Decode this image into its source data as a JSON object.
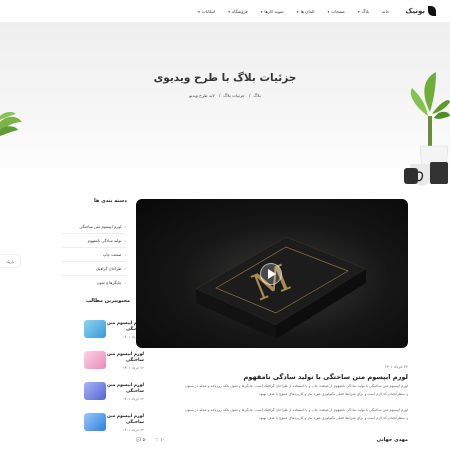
{
  "brand": {
    "name": "بونیک"
  },
  "nav": {
    "items": [
      {
        "label": "خانه"
      },
      {
        "label": "بلاگ"
      },
      {
        "label": "صفحات"
      },
      {
        "label": "المان ها"
      },
      {
        "label": "نمونه کارها"
      },
      {
        "label": "فروشگاه"
      },
      {
        "label": "امکانات"
      }
    ]
  },
  "hero": {
    "title": "جزئیات بلاگ با طرح ویدیوی",
    "crumbs": [
      "بلاگ",
      "جزئیات بلاگ",
      "لاید طرح ویدیو"
    ]
  },
  "sidebar": {
    "categories_title": "دسته بندی ها",
    "categories": [
      "لورم ایپسوم متن ساختگی",
      "تولید سادگی نامفهوم",
      "صنعت چاپ",
      "طراحان گرافیک",
      "چاپگرها و متون"
    ],
    "popular_title": "محبوبترین مطالب",
    "popular": [
      {
        "title": "لورم ایپسوم متن ساختگی",
        "date": "۲۶ خرداد ۱۴۰۱",
        "color": "#5bb6e6"
      },
      {
        "title": "لورم ایپسوم متن ساختگی",
        "date": "۲۲ خرداد ۱۴۰۱",
        "color": "#f3a8c8"
      },
      {
        "title": "لورم ایپسوم متن ساختگی",
        "date": "۲۲ خرداد ۱۴۰۱",
        "color": "#6b7fe0"
      },
      {
        "title": "لورم ایپسوم متن ساختگی",
        "date": "۲۲ خرداد ۱۴۰۱",
        "color": "#3b8ee6"
      }
    ]
  },
  "float_tab": {
    "label": "تاریک"
  },
  "post": {
    "date": "۲۴ خرداد ۱۴۰۱",
    "title": "لورم ایپسوم متن ساختگی با تولید سادگی نامفهوم",
    "p1": "لورم ایپسوم متن ساختگی با تولید سادگی نامفهوم از صنعت چاپ و با استفاده از طراحان گرافیک است. چاپگرها و متون بلکه روزنامه و مجله در ستون",
    "p1b": "و سطرآنچنان که لازم است و برای شرایط فعلی تکنولوژی مورد نیاز و کاربردهای متنوع با هدف بهبود",
    "p2": "لورم ایپسوم متن ساختگی با تولید سادگی نامفهوم از صنعت چاپ و با استفاده از طراحان گرافیک است. چاپگرها و متون بلکه روزنامه و مجله در ستون",
    "p2b": "و سطرآنچنان که لازم است و برای شرایط فعلی تکنولوژی مورد نیاز و کاربردهای متنوع با هدف بهبود",
    "author": "مهدی جهانی",
    "likes": "۱۰",
    "comments": "۵۰"
  }
}
